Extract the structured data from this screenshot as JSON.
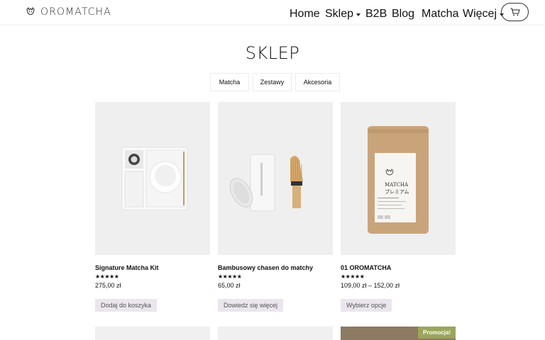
{
  "header": {
    "logo_text": "OROMATCHA",
    "nav": [
      {
        "label": "Home",
        "has_dropdown": false
      },
      {
        "label": "Sklep",
        "has_dropdown": true
      },
      {
        "label": "B2B",
        "has_dropdown": false
      },
      {
        "label": "Blog",
        "has_dropdown": false
      },
      {
        "label": "Matcha",
        "has_dropdown": false
      },
      {
        "label": "Więcej",
        "has_dropdown": true
      }
    ],
    "cart_icon": "cart-icon"
  },
  "page": {
    "title": "SKLEP",
    "categories": [
      "Matcha",
      "Zestawy",
      "Akcesoria"
    ]
  },
  "products": [
    {
      "title": "Signature Matcha Kit",
      "rating": "★★★★★",
      "price": "275,00 zł",
      "action": "Dodaj do koszyka"
    },
    {
      "title": "Bambusowy chasen do matchy",
      "rating": "★★★★★",
      "price": "65,00 zł",
      "action": "Dowiedz się więcej"
    },
    {
      "title": "01 OROMATCHA",
      "rating": "★★★★★",
      "price": "109,00 zł – 152,00 zł",
      "action": "Wybierz opcje"
    }
  ],
  "bag_label": {
    "line1": "MATCHA",
    "line2": "プレミアム"
  },
  "row2": {
    "promo_badge": "Promocja!"
  },
  "colors": {
    "button_bg": "#ebe6ee",
    "promo_bg": "#9aa65a",
    "kraft": "#c9a47b"
  }
}
